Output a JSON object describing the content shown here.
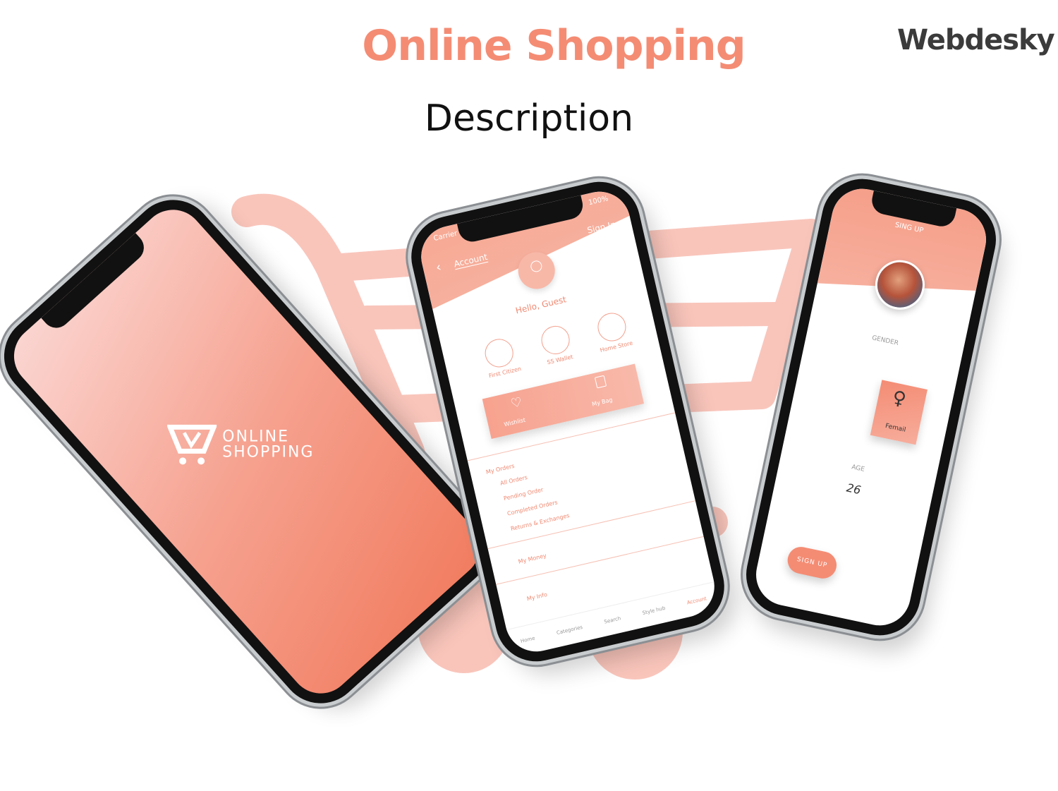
{
  "header": {
    "title": "Online Shopping",
    "subtitle": "Description",
    "logo_text": "Webdesky"
  },
  "colors": {
    "accent": "#f48c74",
    "accent_light": "#f9c7bc",
    "text_dark": "#111111"
  },
  "phone1": {
    "brand_line1": "ONLINE",
    "brand_line2": "SHOPPING"
  },
  "phone2": {
    "status_carrier": "Carrier",
    "status_battery": "100%",
    "nav_title": "Account",
    "sign_in": "Sign In",
    "greeting": "Hello, Guest",
    "quick_links": [
      {
        "label": "First Citizen",
        "icon": "card-icon"
      },
      {
        "label": "SS Wallet",
        "icon": "wallet-icon"
      },
      {
        "label": "Home Store",
        "icon": "store-icon"
      }
    ],
    "wishlist": "Wishlist",
    "my_bag": "My Bag",
    "orders_heading": "My Orders",
    "order_items": [
      "All Orders",
      "Pending Order",
      "Completed Orders",
      "Returns & Exchanges"
    ],
    "my_money": "My Money",
    "my_info": "My Info",
    "tabs": [
      "Home",
      "Categories",
      "Search",
      "Style hub",
      "Account"
    ]
  },
  "phone3": {
    "heading": "SING UP",
    "gender_label": "GENDER",
    "gender_value": "Femail",
    "age_label": "AGE",
    "age_value": "26",
    "signup_button": "SIGN UP"
  }
}
